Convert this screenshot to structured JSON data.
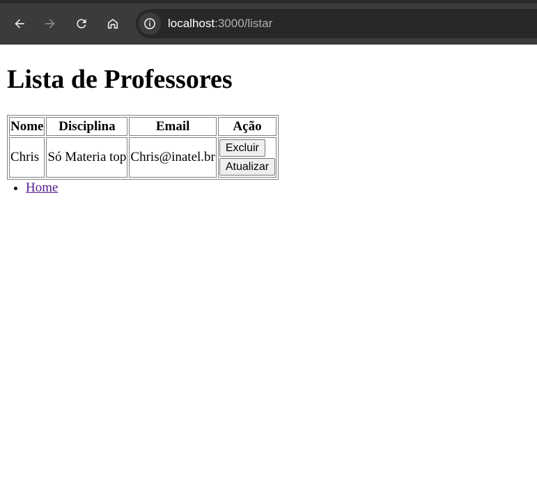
{
  "browser": {
    "url_host": "localhost",
    "url_rest": ":3000/listar"
  },
  "page": {
    "title": "Lista de Professores",
    "table": {
      "headers": [
        "Nome",
        "Disciplina",
        "Email",
        "Ação"
      ],
      "rows": [
        {
          "nome": "Chris",
          "disciplina": "Só Materia top",
          "email": "Chris@inatel.br",
          "actions": {
            "delete_label": "Excluir",
            "update_label": "Atualizar"
          }
        }
      ]
    },
    "nav": {
      "items": [
        {
          "label": "Home"
        }
      ]
    }
  },
  "colors": {
    "toolbar_bg": "#3b3b3b",
    "omnibox_bg": "#282828",
    "visited_link": "#551a8b"
  }
}
